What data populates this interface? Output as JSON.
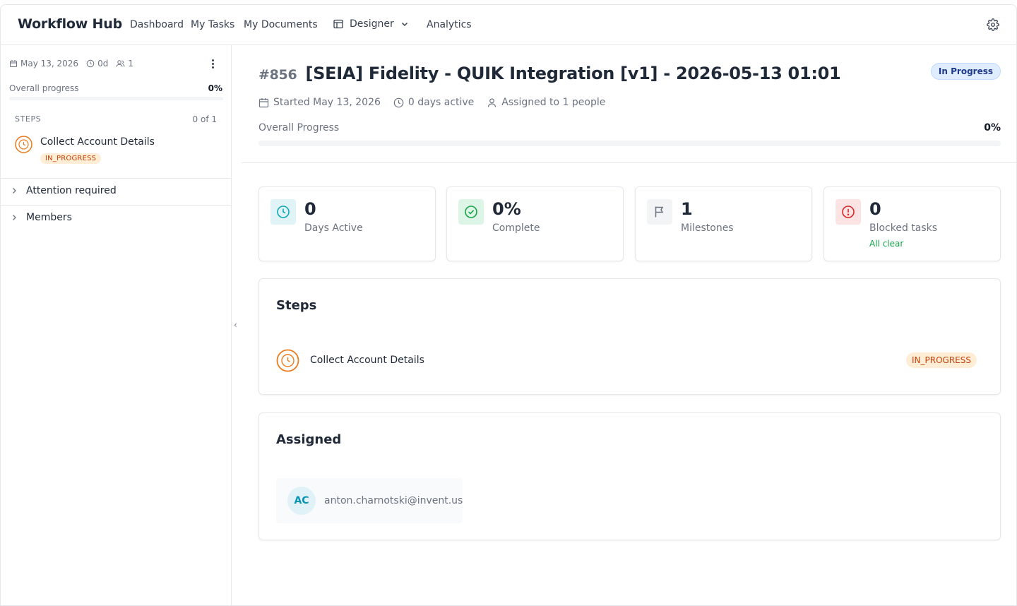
{
  "app": {
    "title": "Workflow Hub"
  },
  "nav": {
    "dashboard": "Dashboard",
    "my_tasks": "My Tasks",
    "my_documents": "My Documents",
    "designer": "Designer",
    "analytics": "Analytics"
  },
  "sidebar": {
    "date": "May 13, 2026",
    "duration": "0d",
    "members_count": "1",
    "overall_label": "Overall progress",
    "overall_value": "0%",
    "overall_fraction": 0,
    "steps_label": "STEPS",
    "steps_count": "0 of 1",
    "step": {
      "title": "Collect Account Details",
      "status": "IN_PROGRESS"
    },
    "sections": [
      "Attention required",
      "Members"
    ]
  },
  "header": {
    "number": "#856",
    "title": "[SEIA] Fidelity - QUIK Integration [v1] - 2026-05-13 01:01",
    "status": "In Progress",
    "started": "Started May 13, 2026",
    "days_active": "0 days active",
    "assigned": "Assigned to 1 people",
    "progress_label": "Overall Progress",
    "progress_value": "0%",
    "progress_fraction": 0
  },
  "stats": [
    {
      "value": "0",
      "label": "Days Active",
      "icon": "clock-icon"
    },
    {
      "value": "0%",
      "label": "Complete",
      "icon": "check-circle-icon"
    },
    {
      "value": "1",
      "label": "Milestones",
      "icon": "flag-icon"
    },
    {
      "value": "0",
      "label": "Blocked tasks",
      "sub": "All clear",
      "icon": "alert-circle-icon"
    }
  ],
  "steps_panel": {
    "title": "Steps",
    "step": {
      "title": "Collect Account Details",
      "status": "IN_PROGRESS"
    }
  },
  "assigned_panel": {
    "title": "Assigned",
    "user": {
      "initials": "AC",
      "email": "anton.charnotski@invent.us"
    }
  },
  "colors": {
    "accent_orange": "#ea7a1c",
    "status_blue_bg": "#e0ecff",
    "teal": "#0ea5b7",
    "green": "#16a34a",
    "red": "#dc2626"
  }
}
